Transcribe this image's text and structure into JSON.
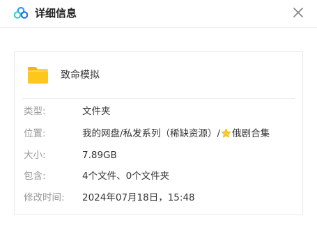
{
  "header": {
    "title": "详细信息",
    "logo_icon": "baidu-netdisk-logo",
    "close_icon": "close-icon"
  },
  "file": {
    "name": "致命模拟",
    "icon": "folder-icon"
  },
  "details": {
    "type_label": "类型:",
    "type_value": "文件夹",
    "location_label": "位置:",
    "location_value_prefix": "我的网盘/私发系列（稀缺资源）/",
    "location_value_suffix": "俄剧合集",
    "location_star_icon": "star-emoji-icon",
    "size_label": "大小:",
    "size_value": "7.89GB",
    "contains_label": "包含:",
    "contains_value": "4个文件、0个文件夹",
    "modified_label": "修改时间:",
    "modified_value": "2024年07月18日，15:48"
  },
  "colors": {
    "folder": "#FFC61B",
    "label": "#999999",
    "text": "#333333",
    "logo_blue": "#2A9BF5",
    "logo_cyan": "#36D1C4"
  }
}
